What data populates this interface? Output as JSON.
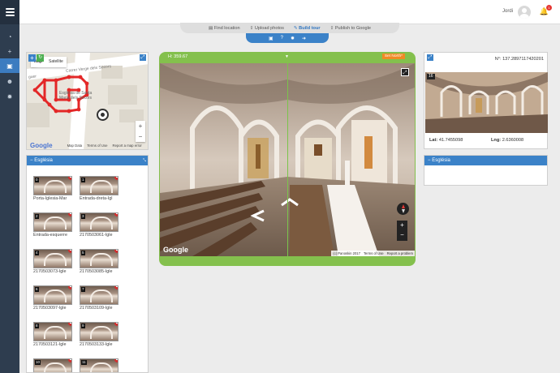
{
  "header": {
    "user_name": "Jordi",
    "notification_count": "1"
  },
  "sidebar": {
    "items": [
      {
        "icon": "dashboard-icon",
        "glyph": "◔",
        "active": false
      },
      {
        "icon": "plus-icon",
        "glyph": "+",
        "active": false
      },
      {
        "icon": "tours-icon",
        "glyph": "▣",
        "active": true
      },
      {
        "icon": "users-icon",
        "glyph": "☻",
        "active": false
      },
      {
        "icon": "settings-icon",
        "glyph": "✹",
        "active": false
      }
    ]
  },
  "steps": [
    {
      "label": "Find location",
      "glyph": "▤",
      "active": false
    },
    {
      "label": "Upload photos",
      "glyph": "⇪",
      "active": false
    },
    {
      "label": "Build tour",
      "glyph": "✎",
      "active": true
    },
    {
      "label": "Publish to Google",
      "glyph": "⇪",
      "active": false
    }
  ],
  "toolbar_icons": [
    "save-icon",
    "help-icon",
    "settings-icon",
    "exit-icon"
  ],
  "map": {
    "type_options": [
      "Map",
      "Satellite"
    ],
    "selected_type": "Map",
    "street_1": "Carrer Verge dels Socors",
    "street_2": "guer",
    "church_label_1": "Església de Santa",
    "church_label_2": "Maria dels Socors",
    "zoom_in": "+",
    "zoom_out": "−",
    "google": "Google",
    "map_data": "Map Data",
    "terms": "Terms of Use",
    "report": "Report a map error"
  },
  "list": {
    "title": "Església",
    "items": [
      {
        "num": "0",
        "label": "Porta-Iglesia-Mar"
      },
      {
        "num": "1",
        "label": "Entrada-dreta-Igl"
      },
      {
        "num": "2",
        "label": "Entrada-esquerre"
      },
      {
        "num": "3",
        "label": "2170503061-Igle"
      },
      {
        "num": "4",
        "label": "2170503073-Igle"
      },
      {
        "num": "5",
        "label": "2170503085-Igle"
      },
      {
        "num": "6",
        "label": "2170503097-Igle"
      },
      {
        "num": "7",
        "label": "2170503109-Igle"
      },
      {
        "num": "8",
        "label": "2170503121-Igle"
      },
      {
        "num": "9",
        "label": "2170503133-Igle"
      },
      {
        "num": "10",
        "label": ""
      },
      {
        "num": "11",
        "label": ""
      }
    ]
  },
  "pano": {
    "heading": "H: 359.67",
    "set_north": "Set North*",
    "google": "Google",
    "copyright": "(c) Panoskin 2017",
    "terms": "Terms of Use",
    "report": "Report a problem",
    "zoom_in": "+",
    "zoom_out": "−"
  },
  "info": {
    "north_label": "N°: 137.2897117420201",
    "photo_num": "16",
    "lat_label": "Lat:",
    "lat_value": "41.7455098",
    "lng_label": "Lng:",
    "lng_value": "2.6360008"
  },
  "group": {
    "title": "Església"
  }
}
